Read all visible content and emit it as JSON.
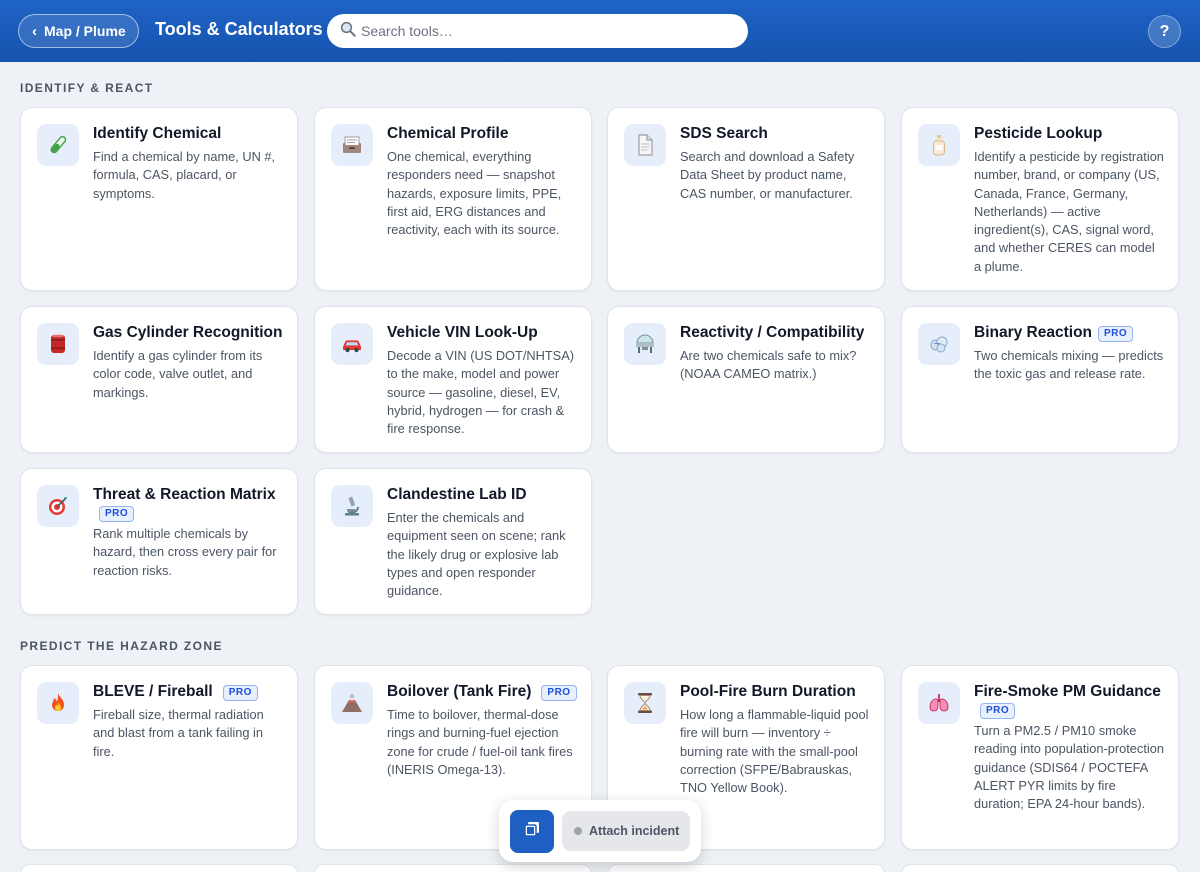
{
  "header": {
    "back_label": "Map / Plume",
    "title": "Tools & Calculators",
    "search_placeholder": "Search tools…",
    "help_label": "?"
  },
  "sections": [
    {
      "title": "IDENTIFY & REACT",
      "cards": [
        {
          "name": "Identify Chemical",
          "icon": "test-tube-icon",
          "pro": false,
          "desc": "Find a chemical by name, UN #, formula, CAS, placard, or symptoms."
        },
        {
          "name": "Chemical Profile",
          "icon": "file-box-icon",
          "pro": false,
          "desc": "One chemical, everything responders need — snapshot hazards, exposure limits, PPE, first aid, ERG distances and reactivity, each with its source."
        },
        {
          "name": "SDS Search",
          "icon": "document-icon",
          "pro": false,
          "desc": "Search and download a Safety Data Sheet by product name, CAS number, or manufacturer."
        },
        {
          "name": "Pesticide Lookup",
          "icon": "lotion-bottle-icon",
          "pro": false,
          "desc": "Identify a pesticide by registration number, brand, or company (US, Canada, France, Germany, Netherlands) — active ingredient(s), CAS, signal word, and whether CERES can model a plume."
        },
        {
          "name": "Gas Cylinder Recognition",
          "icon": "barrel-icon",
          "pro": false,
          "desc": "Identify a gas cylinder from its color code, valve outlet, and markings."
        },
        {
          "name": "Vehicle VIN Look-Up",
          "icon": "car-icon",
          "pro": false,
          "desc": "Decode a VIN (US DOT/NHTSA) to the make, model and power source — gasoline, diesel, EV, hybrid, hydrogen — for crash & fire response."
        },
        {
          "name": "Reactivity / Compatibility",
          "icon": "flask-icon",
          "pro": false,
          "desc": "Are two chemicals safe to mix? (NOAA CAMEO matrix.)"
        },
        {
          "name": "Binary Reaction",
          "icon": "gas-cloud-icon",
          "pro": true,
          "desc": "Two chemicals mixing — predicts the toxic gas and release rate."
        },
        {
          "name": "Threat & Reaction Matrix",
          "icon": "target-icon",
          "pro": true,
          "desc": "Rank multiple chemicals by hazard, then cross every pair for reaction risks."
        },
        {
          "name": "Clandestine Lab ID",
          "icon": "microscope-icon",
          "pro": false,
          "desc": "Enter the chemicals and equipment seen on scene; rank the likely drug or explosive lab types and open responder guidance."
        }
      ]
    },
    {
      "title": "PREDICT THE HAZARD ZONE",
      "cards": [
        {
          "name": "BLEVE / Fireball",
          "icon": "fire-icon",
          "pro": true,
          "desc": "Fireball size, thermal radiation and blast from a tank failing in fire."
        },
        {
          "name": "Boilover (Tank Fire)",
          "icon": "volcano-icon",
          "pro": true,
          "desc": "Time to boilover, thermal-dose rings and burning-fuel ejection zone for crude / fuel-oil tank fires (INERIS Omega-13)."
        },
        {
          "name": "Pool-Fire Burn Duration",
          "icon": "hourglass-icon",
          "pro": false,
          "desc": "How long a flammable-liquid pool fire will burn — inventory ÷ burning rate with the small-pool correction (SFPE/Babrauskas, TNO Yellow Book)."
        },
        {
          "name": "Fire-Smoke PM Guidance",
          "icon": "lungs-icon",
          "pro": true,
          "desc": "Turn a PM2.5 / PM10 smoke reading into population-protection guidance (SDIS64 / POCTEFA ALERT PYR limits by fire duration; EPA 24-hour bands)."
        }
      ]
    }
  ],
  "pro_label": "PRO",
  "floating_bar": {
    "attach_label": "Attach incident",
    "copy_icon": "copy-icon"
  }
}
